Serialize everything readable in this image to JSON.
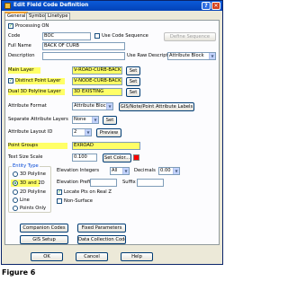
{
  "window": {
    "title": "Edit Field Code Definition",
    "help_glyph": "?",
    "close_glyph": "✕"
  },
  "tabs": [
    "General",
    "Symbol",
    "Linetype"
  ],
  "processing": {
    "label": "Processing ON",
    "checked": true
  },
  "code": {
    "label": "Code",
    "value": "BOC"
  },
  "use_code_sequence": {
    "label": "Use Code Sequence",
    "checked": false
  },
  "define_sequence": "Define Sequence",
  "full_name": {
    "label": "Full Name",
    "value": "BACK OF CURB"
  },
  "description": {
    "label": "Description",
    "value": ""
  },
  "use_raw_description": {
    "label": "Use Raw Description",
    "value": "Attribute Block"
  },
  "main_layer": {
    "label": "Main Layer",
    "value": "V-ROAD-CURB-BACK",
    "button": "Set"
  },
  "distinct_point_layer": {
    "label": "Distinct Point Layer",
    "checked": true,
    "value": "V-NODE-CURB-BACK",
    "button": "Set"
  },
  "dual_3d_polyline_layer": {
    "label": "Dual 3D Polyline Layer",
    "value": "3D EXISTING",
    "button": "Set"
  },
  "attribute_format": {
    "label": "Attribute Format",
    "value": "Attribute Block"
  },
  "gis_note_button": "GIS/Note/Point Attribute Labels",
  "separate_attribute_layers": {
    "label": "Separate Attribute Layers",
    "value": "None",
    "button": "Set"
  },
  "attribute_layout_id": {
    "label": "Attribute Layout ID",
    "value": "2",
    "button": "Preview"
  },
  "point_groups": {
    "label": "Point Groups",
    "value": "EXROAD"
  },
  "text_size_scale": {
    "label": "Text Size Scale",
    "value": "0.100"
  },
  "set_color": "Set Color...",
  "entity_type": {
    "legend": "Entity Type",
    "options": [
      "3D Polyline",
      "3D and 2D",
      "2D Polyline",
      "Line",
      "Points Only"
    ],
    "selected": "3D and 2D"
  },
  "elevation_integers": {
    "label": "Elevation Integers",
    "value": "All"
  },
  "decimals": {
    "label": "Decimals",
    "value": "0.00"
  },
  "elevation_prefix": {
    "label": "Elevation Prefix",
    "value": ""
  },
  "suffix": {
    "label": "Suffix",
    "value": ""
  },
  "locate_pts_on_real_z": {
    "label": "Locate Pts on Real Z",
    "checked": true
  },
  "non_surface": {
    "label": "Non-Surface",
    "checked": false
  },
  "buttons": {
    "companion_codes": "Companion Codes",
    "fixed_parameters": "Fixed Parameters",
    "gis_setup": "GIS Setup",
    "data_collection_codes": "Data Collection Codes",
    "ok": "OK",
    "cancel": "Cancel",
    "help": "Help"
  },
  "caption": "Figure 6"
}
